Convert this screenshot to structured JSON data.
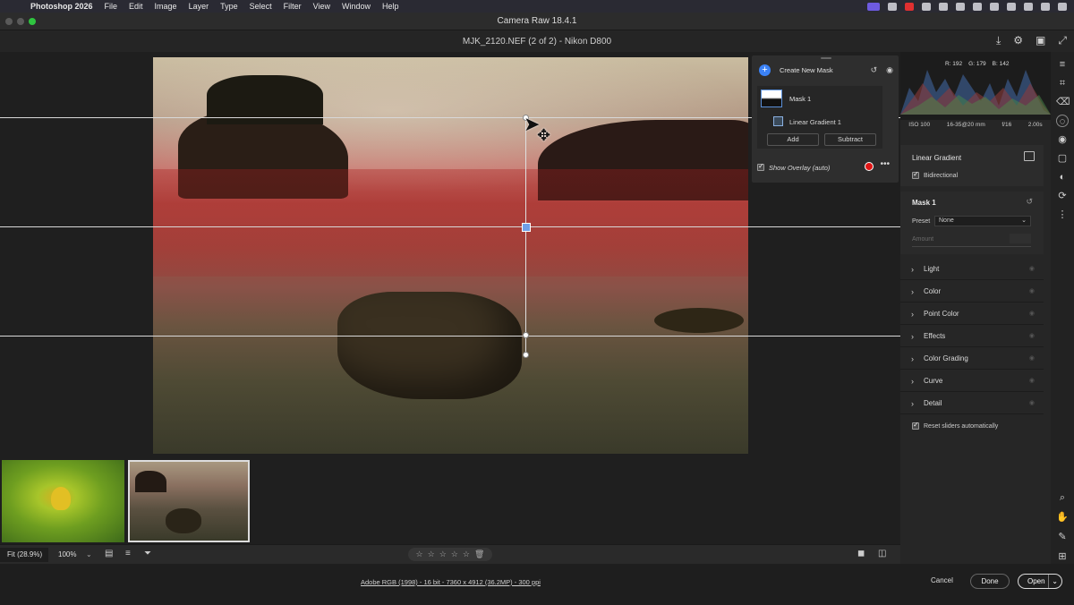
{
  "menubar": {
    "app_name": "Photoshop 2026",
    "items": [
      "File",
      "Edit",
      "Image",
      "Layer",
      "Type",
      "Select",
      "Filter",
      "View",
      "Window",
      "Help"
    ]
  },
  "window": {
    "title": "Camera Raw 18.4.1",
    "file_title": "MJK_2120.NEF (2 of 2)  -  Nikon D800"
  },
  "mask_panel": {
    "create_label": "Create New Mask",
    "mask_name": "Mask 1",
    "component_name": "Linear Gradient 1",
    "add_label": "Add",
    "subtract_label": "Subtract",
    "overlay_label": "Show Overlay (auto)",
    "overlay_color": "#e01515"
  },
  "histogram": {
    "r": "R: 192",
    "g": "G: 179",
    "b": "B: 142"
  },
  "meta": {
    "iso": "ISO 100",
    "lens": "16-35@20 mm",
    "aperture": "f/16",
    "shutter": "2.00s"
  },
  "linear_gradient": {
    "title": "Linear Gradient",
    "bidirectional": "Bidirectional"
  },
  "mask_settings": {
    "title": "Mask 1",
    "preset_label": "Preset",
    "preset_value": "None",
    "amount_label": "Amount"
  },
  "sections": [
    "Light",
    "Color",
    "Point Color",
    "Effects",
    "Color Grading",
    "Curve",
    "Detail"
  ],
  "reset_label": "Reset sliders automatically",
  "bottombar": {
    "fit": "Fit (28.9%)",
    "zoom": "100%"
  },
  "footer": {
    "fileinfo": "Adobe RGB (1998) - 16 bit - 7360 x 4912 (36.2MP) - 300 ppi",
    "cancel": "Cancel",
    "done": "Done",
    "open": "Open"
  }
}
